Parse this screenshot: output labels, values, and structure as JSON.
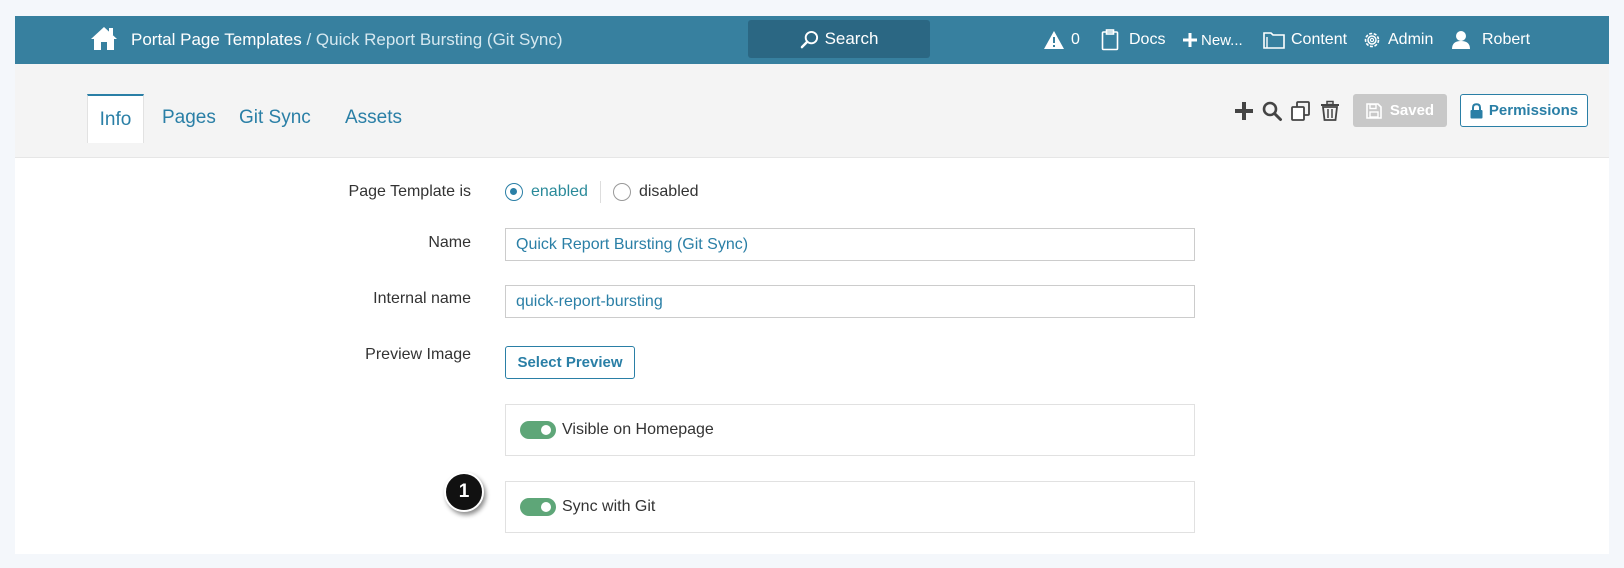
{
  "header": {
    "breadcrumb_root": "Portal Page Templates",
    "breadcrumb_sep": " / ",
    "breadcrumb_current": "Quick Report Bursting (Git Sync)",
    "search_label": "Search",
    "alerts_count": "0",
    "docs_label": "Docs",
    "new_label": "New...",
    "content_label": "Content",
    "admin_label": "Admin",
    "user_label": "Robert"
  },
  "tabs": [
    {
      "label": "Info",
      "active": true
    },
    {
      "label": "Pages",
      "active": false
    },
    {
      "label": "Git Sync",
      "active": false
    },
    {
      "label": "Assets",
      "active": false
    }
  ],
  "toolbar": {
    "saved_label": "Saved",
    "permissions_label": "Permissions",
    "icons": [
      "plus-icon",
      "search-icon",
      "copy-icon",
      "trash-icon"
    ]
  },
  "form": {
    "status_label": "Page Template is",
    "status_options": [
      "enabled",
      "disabled"
    ],
    "status_selected": "enabled",
    "name_label": "Name",
    "name_value": "Quick Report Bursting (Git Sync)",
    "internal_name_label": "Internal name",
    "internal_name_value": "quick-report-bursting",
    "preview_label": "Preview Image",
    "preview_button": "Select Preview",
    "visible_label": "Visible on Homepage",
    "visible_on": true,
    "sync_label": "Sync with Git",
    "sync_on": true
  },
  "annotation": {
    "step_number": "1"
  },
  "colors": {
    "header_bg": "#37809f",
    "accent": "#2a7fa6",
    "toggle_on": "#5ea678"
  }
}
